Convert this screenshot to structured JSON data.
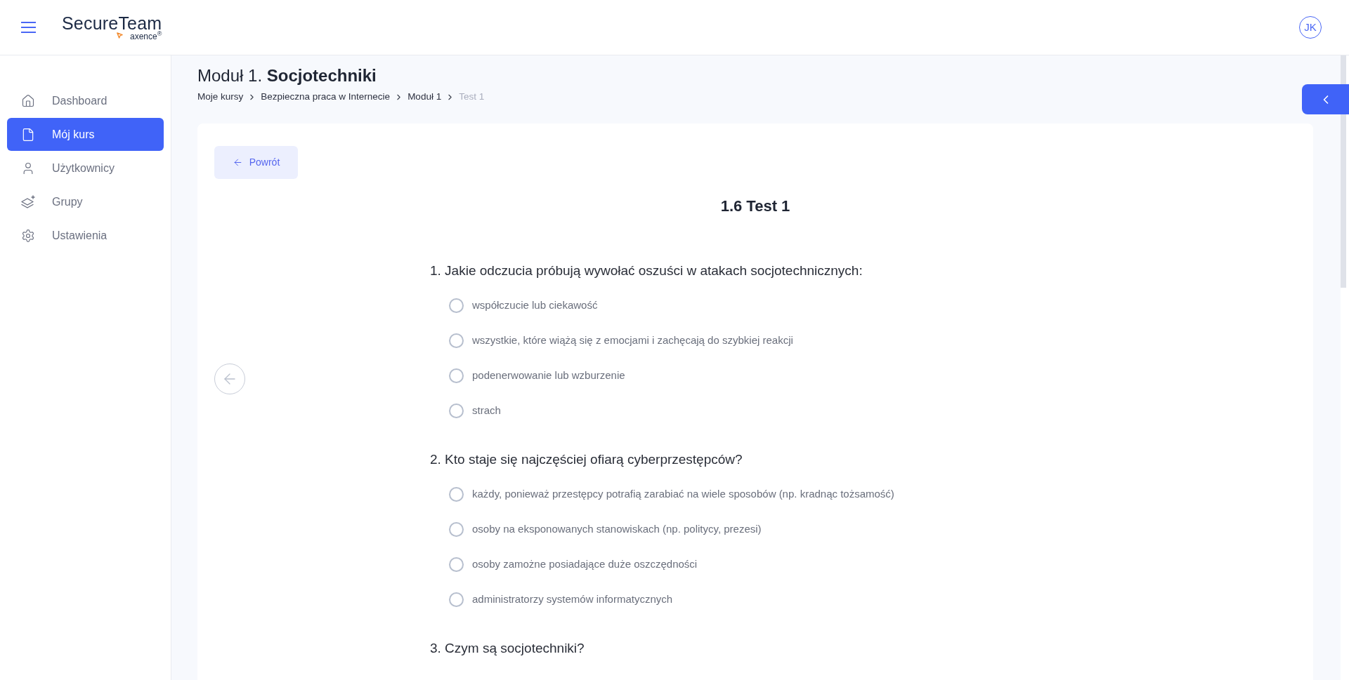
{
  "header": {
    "logo": {
      "wordmark": "SecureTeam",
      "tagline": "axence$^{®}$"
    },
    "avatar": "JK"
  },
  "sidebar": {
    "items": [
      {
        "label": "Dashboard",
        "selected": false
      },
      {
        "label": "Mój kurs",
        "selected": true
      },
      {
        "label": "Użytkownicy",
        "selected": false
      },
      {
        "label": "Grupy",
        "selected": false
      },
      {
        "label": "Ustawienia",
        "selected": false
      }
    ]
  },
  "page": {
    "title": "Moduł 1. **Socjotechniki**",
    "breadcrumb": [
      {
        "label": "Moje kursy",
        "current": false
      },
      {
        "label": "Bezpieczna praca w Internecie",
        "current": false
      },
      {
        "label": "Moduł 1",
        "current": false
      },
      {
        "label": "Test 1",
        "current": true
      }
    ]
  },
  "test": {
    "back_button": "Powrót",
    "title": "1.6 Test 1",
    "questions": [
      {
        "text": "1. Jakie odczucia próbują wywołać oszuści w atakach socjotechnicznych:",
        "options": [
          {
            "label": "współczucie lub ciekawość",
            "selected": false
          },
          {
            "label": "wszystkie, które wiążą się z emocjami i zachęcają do szybkiej reakcji",
            "selected": false
          },
          {
            "label": "podenerwowanie lub wzburzenie",
            "selected": false
          },
          {
            "label": "strach",
            "selected": false
          }
        ]
      },
      {
        "text": "2. Kto staje się najczęściej ofiarą cyberprzestępców?",
        "options": [
          {
            "label": "każdy, ponieważ przestępcy potrafią zarabiać na wiele sposobów (np. kradnąc tożsamość)",
            "selected": false
          },
          {
            "label": "osoby na eksponowanych stanowiskach (np. politycy, prezesi)",
            "selected": false
          },
          {
            "label": "osoby zamożne posiadające duże oszczędności",
            "selected": false
          },
          {
            "label": "administratorzy systemów informatycznych",
            "selected": false
          }
        ]
      },
      {
        "text": "3. Czym są socjotechniki?"
      }
    ]
  }
}
